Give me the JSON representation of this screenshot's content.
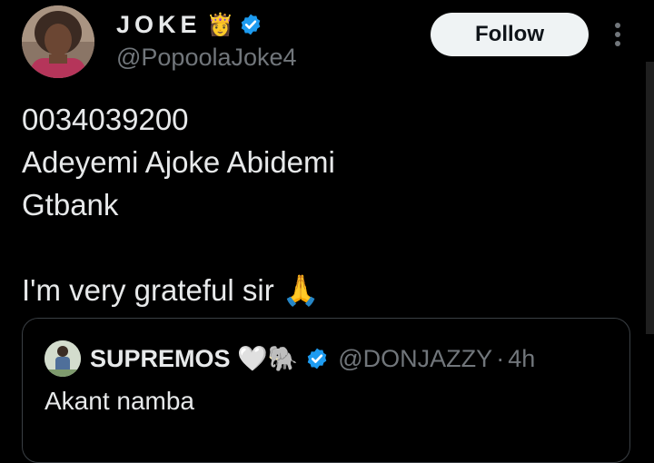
{
  "author": {
    "display_name": "JOKE",
    "name_emoji": "👸",
    "handle": "@PopoolaJoke4",
    "verified": true,
    "avatar_icon": "profile-photo"
  },
  "follow_button": {
    "label": "Follow"
  },
  "more_menu": {
    "icon": "vertical-ellipsis-icon"
  },
  "tweet": {
    "lines": [
      "0034039200",
      "Adeyemi Ajoke Abidemi",
      "Gtbank",
      "",
      "I'm very grateful sir 🙏"
    ]
  },
  "quoted_tweet": {
    "display_name": "SUPREMOS 🤍🐘",
    "verified": true,
    "handle": "@DONJAZZY",
    "separator": "·",
    "time": "4h",
    "text": "Akant namba"
  },
  "colors": {
    "background": "#000000",
    "text": "#e7e9ea",
    "muted": "#71767b",
    "verified_blue": "#1d9bf0",
    "follow_bg": "#eff3f4",
    "border": "#3a3f44"
  }
}
